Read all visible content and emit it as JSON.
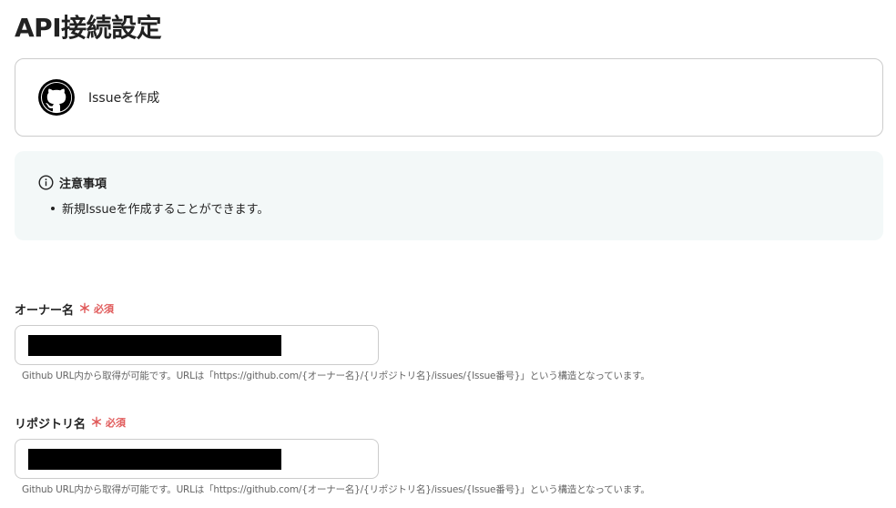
{
  "page": {
    "title": "API接続設定"
  },
  "action": {
    "label": "Issueを作成",
    "icon": "github-icon"
  },
  "notice": {
    "title": "注意事項",
    "icon": "info-icon",
    "items": [
      "新規Issueを作成することができます。"
    ]
  },
  "fields": [
    {
      "label": "オーナー名",
      "required_mark": "＊",
      "required_text": "必須",
      "value": "",
      "help": "Github URL内から取得が可能です。URLは「https://github.com/{オーナー名}/{リポジトリ名}/issues/{Issue番号}」という構造となっています。"
    },
    {
      "label": "リポジトリ名",
      "required_mark": "＊",
      "required_text": "必須",
      "value": "",
      "help": "Github URL内から取得が可能です。URLは「https://github.com/{オーナー名}/{リポジトリ名}/issues/{Issue番号}」という構造となっています。"
    }
  ],
  "colors": {
    "required": "#e05a5a",
    "notice_bg": "#f3f8f8",
    "border": "#cccccc"
  }
}
